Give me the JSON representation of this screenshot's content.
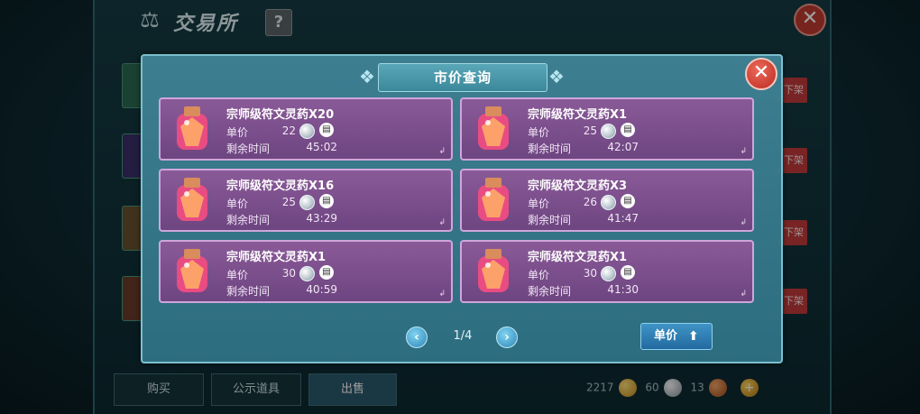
{
  "background": {
    "title": "交易所",
    "help": "?",
    "delist_label": "下架",
    "tabs": {
      "buy": "购买",
      "public": "公示道具",
      "sell": "出售"
    },
    "currency": {
      "gold": "2217",
      "silver": "60",
      "bronze": "13"
    }
  },
  "modal": {
    "title": "市价查询",
    "price_label": "单价",
    "time_label": "剩余时间",
    "items": [
      {
        "name": "宗师级符文灵药X20",
        "price": "22",
        "time": "45:02"
      },
      {
        "name": "宗师级符文灵药X1",
        "price": "25",
        "time": "42:07"
      },
      {
        "name": "宗师级符文灵药X16",
        "price": "25",
        "time": "43:29"
      },
      {
        "name": "宗师级符文灵药X3",
        "price": "26",
        "time": "41:47"
      },
      {
        "name": "宗师级符文灵药X1",
        "price": "30",
        "time": "40:59"
      },
      {
        "name": "宗师级符文灵药X1",
        "price": "30",
        "time": "41:30"
      }
    ],
    "pagination": {
      "current": "1/4"
    },
    "sort_button": "单价"
  },
  "colors": {
    "card": "#7a4f8c",
    "modal": "#33748a",
    "close": "#c13a32"
  },
  "icons": [
    "balance-icon",
    "help-icon",
    "close-icon",
    "potion-icon",
    "silver-gem-icon",
    "document-icon",
    "chevron-left-icon",
    "chevron-right-icon",
    "arrow-up-icon"
  ]
}
